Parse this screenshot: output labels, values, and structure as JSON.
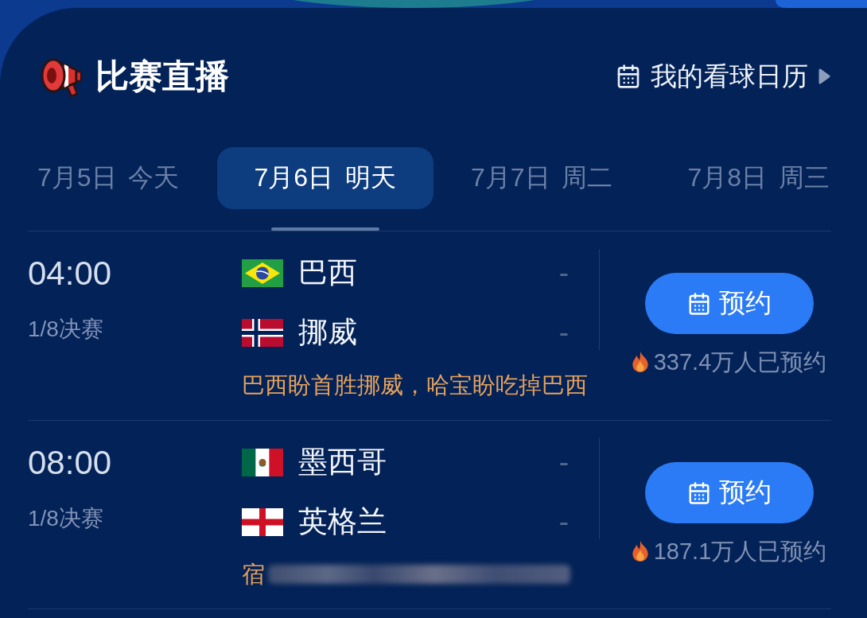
{
  "header": {
    "title": "比赛直播",
    "calendar_link": "我的看球日历"
  },
  "date_tabs": [
    {
      "label": "7月5日 今天",
      "selected": false
    },
    {
      "label": "7月6日 明天",
      "selected": true
    },
    {
      "label": "7月7日 周二",
      "selected": false
    },
    {
      "label": "7月8日 周三",
      "selected": false
    }
  ],
  "matches": [
    {
      "time": "04:00",
      "stage": "1/8决赛",
      "teams": [
        {
          "kind": "brazil",
          "name": "巴西",
          "score": "-"
        },
        {
          "kind": "norway",
          "name": "挪威",
          "score": "-"
        }
      ],
      "hint": "巴西盼首胜挪威，哈宝盼吃掉巴西",
      "hint_blurred": false,
      "button": "预约",
      "reservations": "337.4万人已预约"
    },
    {
      "time": "08:00",
      "stage": "1/8决赛",
      "teams": [
        {
          "kind": "mexico",
          "name": "墨西哥",
          "score": "-"
        },
        {
          "kind": "england",
          "name": "英格兰",
          "score": "-"
        }
      ],
      "hint": "宿",
      "hint_blurred": true,
      "button": "预约",
      "reservations": "187.1万人已预约"
    }
  ]
}
